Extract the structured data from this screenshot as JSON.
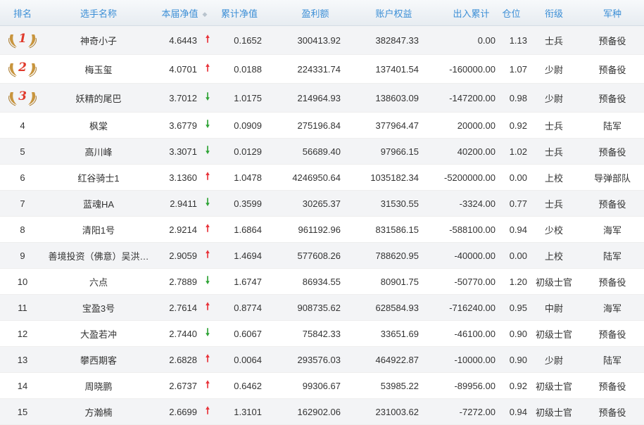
{
  "header": {
    "rank": "排名",
    "name": "选手名称",
    "nav": "本届净值",
    "cumulative_nav": "累计净值",
    "profit": "盈利额",
    "equity": "账户权益",
    "cash_flow": "出入累计",
    "position": "仓位",
    "title": "衔级",
    "arm": "军种"
  },
  "colors": {
    "header_text": "#3c8fd6",
    "up": "#e8333a",
    "down": "#2ea335",
    "medal": "#c8953e",
    "medal_number": "#e03a2c"
  },
  "icons": {
    "sort": "sort-icon",
    "medal": "laurel-medal-icon",
    "up": "up-arrow-icon",
    "down": "down-arrow-icon"
  },
  "rows": [
    {
      "rank": "1",
      "medal": true,
      "name": "神奇小子",
      "nav": "4.6443",
      "trend": "up",
      "cum": "0.1652",
      "profit": "300413.92",
      "equity": "382847.33",
      "flow": "0.00",
      "pos": "1.13",
      "title": "士兵",
      "arm": "预备役"
    },
    {
      "rank": "2",
      "medal": true,
      "name": "梅玉玺",
      "nav": "4.0701",
      "trend": "up",
      "cum": "0.0188",
      "profit": "224331.74",
      "equity": "137401.54",
      "flow": "-160000.00",
      "pos": "1.07",
      "title": "少尉",
      "arm": "预备役"
    },
    {
      "rank": "3",
      "medal": true,
      "name": "妖精的尾巴",
      "nav": "3.7012",
      "trend": "down",
      "cum": "1.0175",
      "profit": "214964.93",
      "equity": "138603.09",
      "flow": "-147200.00",
      "pos": "0.98",
      "title": "少尉",
      "arm": "预备役"
    },
    {
      "rank": "4",
      "medal": false,
      "name": "枫棠",
      "nav": "3.6779",
      "trend": "down",
      "cum": "0.0909",
      "profit": "275196.84",
      "equity": "377964.47",
      "flow": "20000.00",
      "pos": "0.92",
      "title": "士兵",
      "arm": "陆军"
    },
    {
      "rank": "5",
      "medal": false,
      "name": "高川峰",
      "nav": "3.3071",
      "trend": "down",
      "cum": "0.0129",
      "profit": "56689.40",
      "equity": "97966.15",
      "flow": "40200.00",
      "pos": "1.02",
      "title": "士兵",
      "arm": "预备役"
    },
    {
      "rank": "6",
      "medal": false,
      "name": "红谷骑士1",
      "nav": "3.1360",
      "trend": "up",
      "cum": "1.0478",
      "profit": "4246950.64",
      "equity": "1035182.34",
      "flow": "-5200000.00",
      "pos": "0.00",
      "title": "上校",
      "arm": "导弹部队"
    },
    {
      "rank": "7",
      "medal": false,
      "name": "蓝魂HA",
      "nav": "2.9411",
      "trend": "down",
      "cum": "0.3599",
      "profit": "30265.37",
      "equity": "31530.55",
      "flow": "-3324.00",
      "pos": "0.77",
      "title": "士兵",
      "arm": "预备役"
    },
    {
      "rank": "8",
      "medal": false,
      "name": "清阳1号",
      "nav": "2.9214",
      "trend": "up",
      "cum": "1.6864",
      "profit": "961192.96",
      "equity": "831586.15",
      "flow": "-588100.00",
      "pos": "0.94",
      "title": "少校",
      "arm": "海军"
    },
    {
      "rank": "9",
      "medal": false,
      "name": "善境投资（佛意）吴洪…",
      "nav": "2.9059",
      "trend": "up",
      "cum": "1.4694",
      "profit": "577608.26",
      "equity": "788620.95",
      "flow": "-40000.00",
      "pos": "0.00",
      "title": "上校",
      "arm": "陆军"
    },
    {
      "rank": "10",
      "medal": false,
      "name": "六点",
      "nav": "2.7889",
      "trend": "down",
      "cum": "1.6747",
      "profit": "86934.55",
      "equity": "80901.75",
      "flow": "-50770.00",
      "pos": "1.20",
      "title": "初级士官",
      "arm": "预备役"
    },
    {
      "rank": "11",
      "medal": false,
      "name": "宝盈3号",
      "nav": "2.7614",
      "trend": "up",
      "cum": "0.8774",
      "profit": "908735.62",
      "equity": "628584.93",
      "flow": "-716240.00",
      "pos": "0.95",
      "title": "中尉",
      "arm": "海军"
    },
    {
      "rank": "12",
      "medal": false,
      "name": "大盈若冲",
      "nav": "2.7440",
      "trend": "down",
      "cum": "0.6067",
      "profit": "75842.33",
      "equity": "33651.69",
      "flow": "-46100.00",
      "pos": "0.90",
      "title": "初级士官",
      "arm": "预备役"
    },
    {
      "rank": "13",
      "medal": false,
      "name": "攀西期客",
      "nav": "2.6828",
      "trend": "up",
      "cum": "0.0064",
      "profit": "293576.03",
      "equity": "464922.87",
      "flow": "-10000.00",
      "pos": "0.90",
      "title": "少尉",
      "arm": "陆军"
    },
    {
      "rank": "14",
      "medal": false,
      "name": "周晓鹏",
      "nav": "2.6737",
      "trend": "up",
      "cum": "0.6462",
      "profit": "99306.67",
      "equity": "53985.22",
      "flow": "-89956.00",
      "pos": "0.92",
      "title": "初级士官",
      "arm": "预备役"
    },
    {
      "rank": "15",
      "medal": false,
      "name": "方瀚楠",
      "nav": "2.6699",
      "trend": "up",
      "cum": "1.3101",
      "profit": "162902.06",
      "equity": "231003.62",
      "flow": "-7272.00",
      "pos": "0.94",
      "title": "初级士官",
      "arm": "预备役"
    }
  ]
}
